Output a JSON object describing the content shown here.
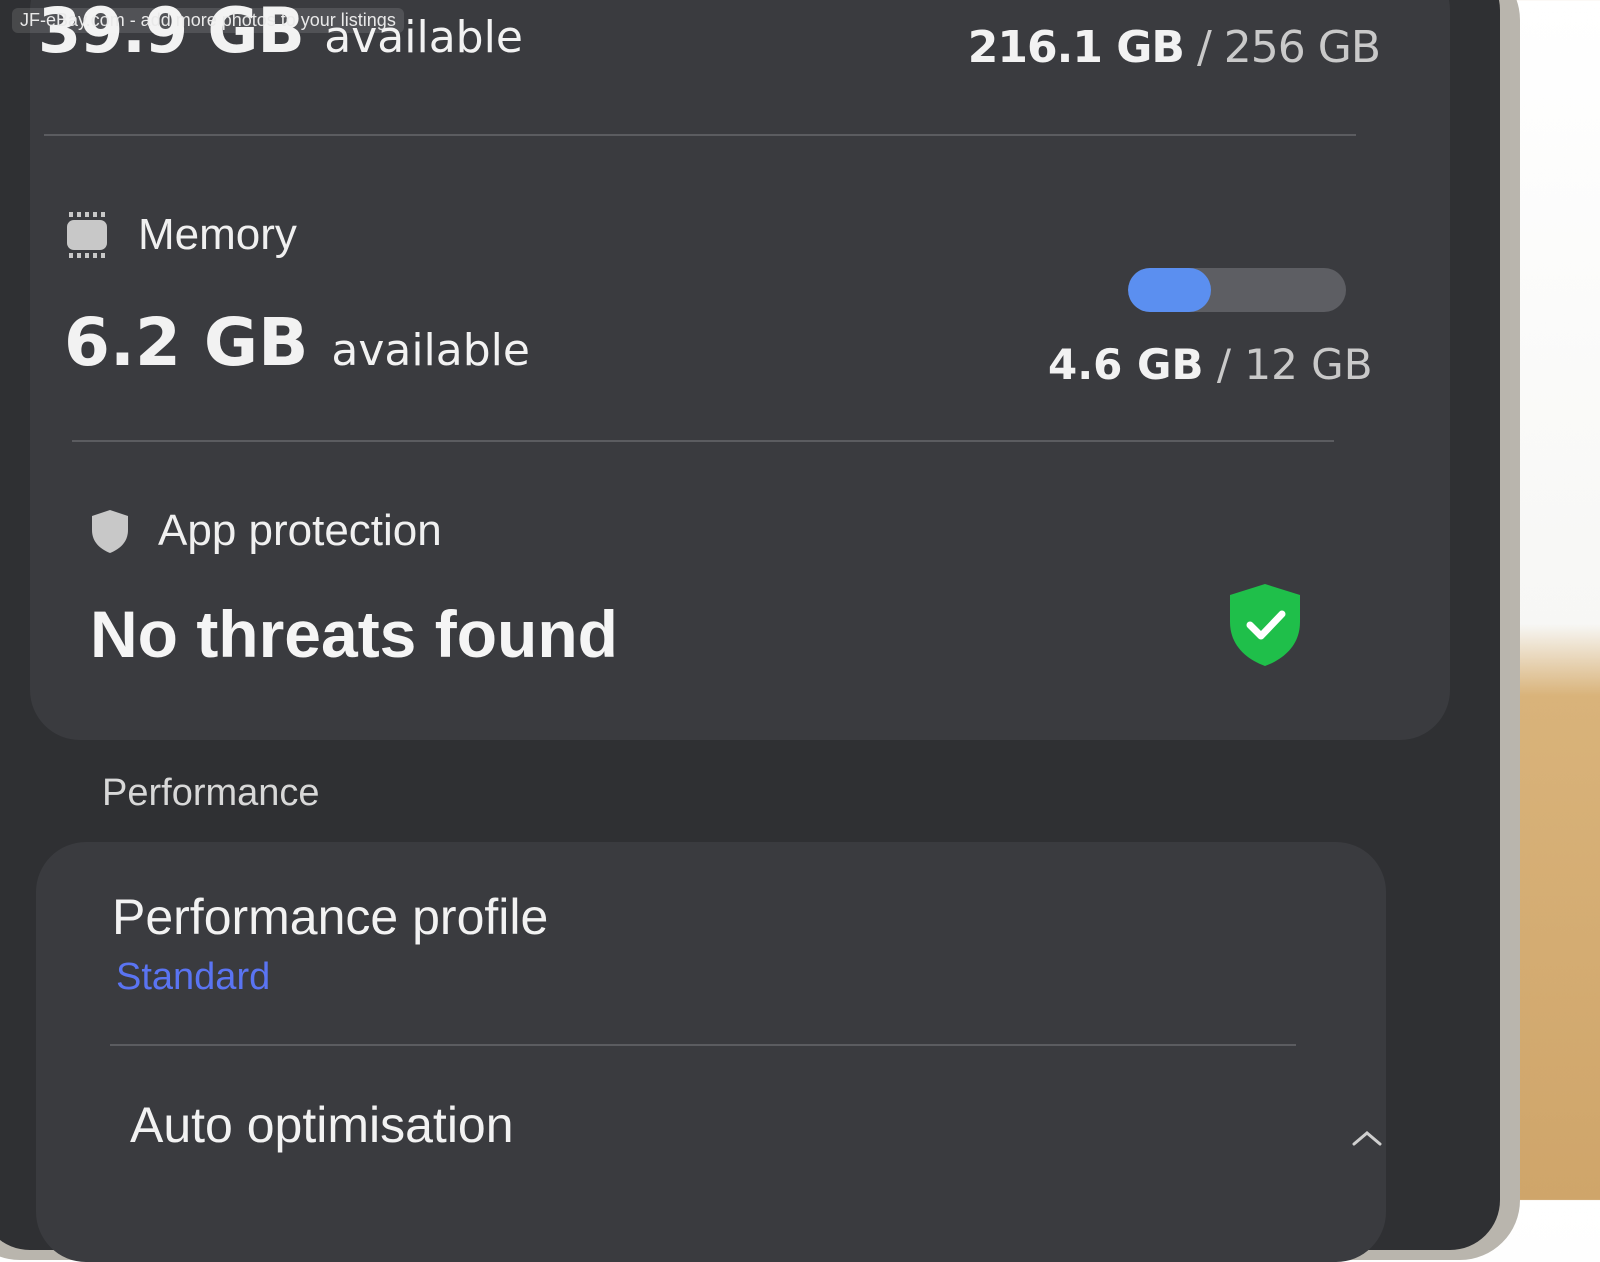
{
  "watermark": "JF-eBay.com - add more photos to your listings",
  "storage": {
    "available_value": "39.9 GB",
    "available_label": "available",
    "used": "216.1 GB",
    "separator": " / ",
    "total": "256 GB"
  },
  "memory": {
    "title": "Memory",
    "available_value": "6.2 GB",
    "available_label": "available",
    "used": "4.6 GB",
    "separator": " / ",
    "total": "12 GB",
    "usage_fraction": 0.38,
    "bar_color": "#5b8ff0"
  },
  "app_protection": {
    "title": "App protection",
    "status": "No threats found",
    "status_icon": "shield-check-icon",
    "status_color": "#1fbf4a"
  },
  "performance": {
    "section_label": "Performance",
    "items": [
      {
        "title": "Performance profile",
        "value": "Standard"
      },
      {
        "title": "Auto optimisation",
        "value": ""
      }
    ]
  }
}
